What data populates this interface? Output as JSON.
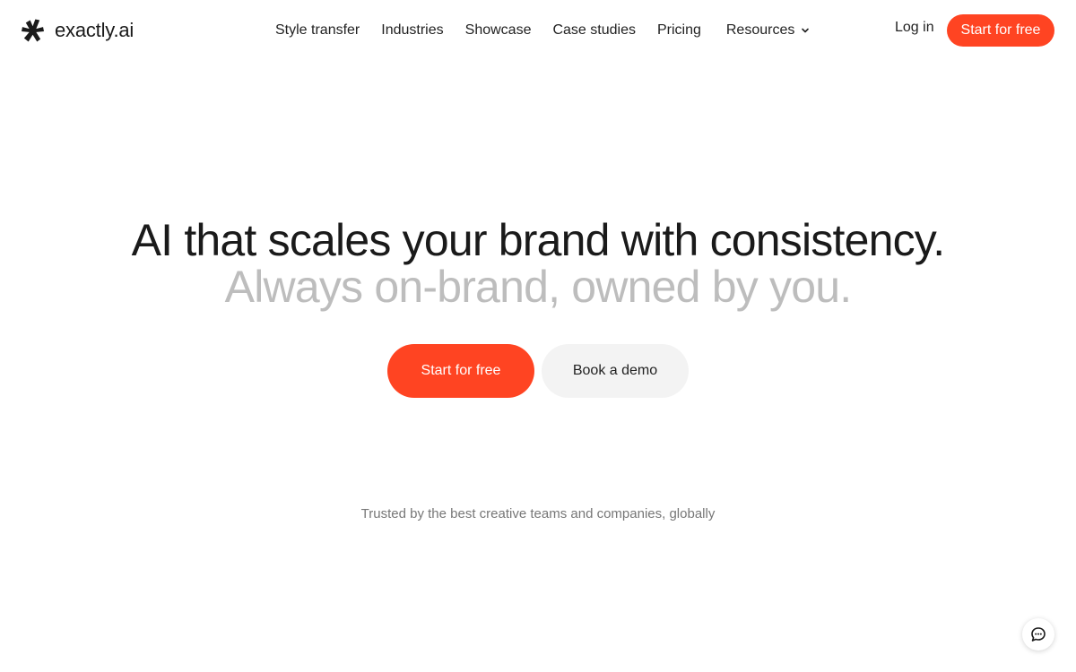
{
  "brand": {
    "name": "exactly.ai",
    "icon": "asterisk-logo-icon"
  },
  "nav": {
    "items": [
      {
        "label": "Style transfer"
      },
      {
        "label": "Industries"
      },
      {
        "label": "Showcase"
      },
      {
        "label": "Case studies"
      },
      {
        "label": "Pricing"
      },
      {
        "label": "Resources",
        "icon": "chevron-down-icon"
      }
    ],
    "login_label": "Log in",
    "cta_label": "Start for free"
  },
  "hero": {
    "headline": "AI that scales your brand with consistency.",
    "subheadline": "Always on-brand, owned by you.",
    "primary_cta": "Start for free",
    "secondary_cta": "Book a demo"
  },
  "trusted": {
    "text": "Trusted by the best creative teams and companies, globally"
  },
  "chat": {
    "icon": "chat-bubble-icon"
  },
  "colors": {
    "accent": "#ff4422",
    "text": "#1a1a1a",
    "muted_headline": "#bdbdbd",
    "secondary_button_bg": "#f3f3f3"
  }
}
